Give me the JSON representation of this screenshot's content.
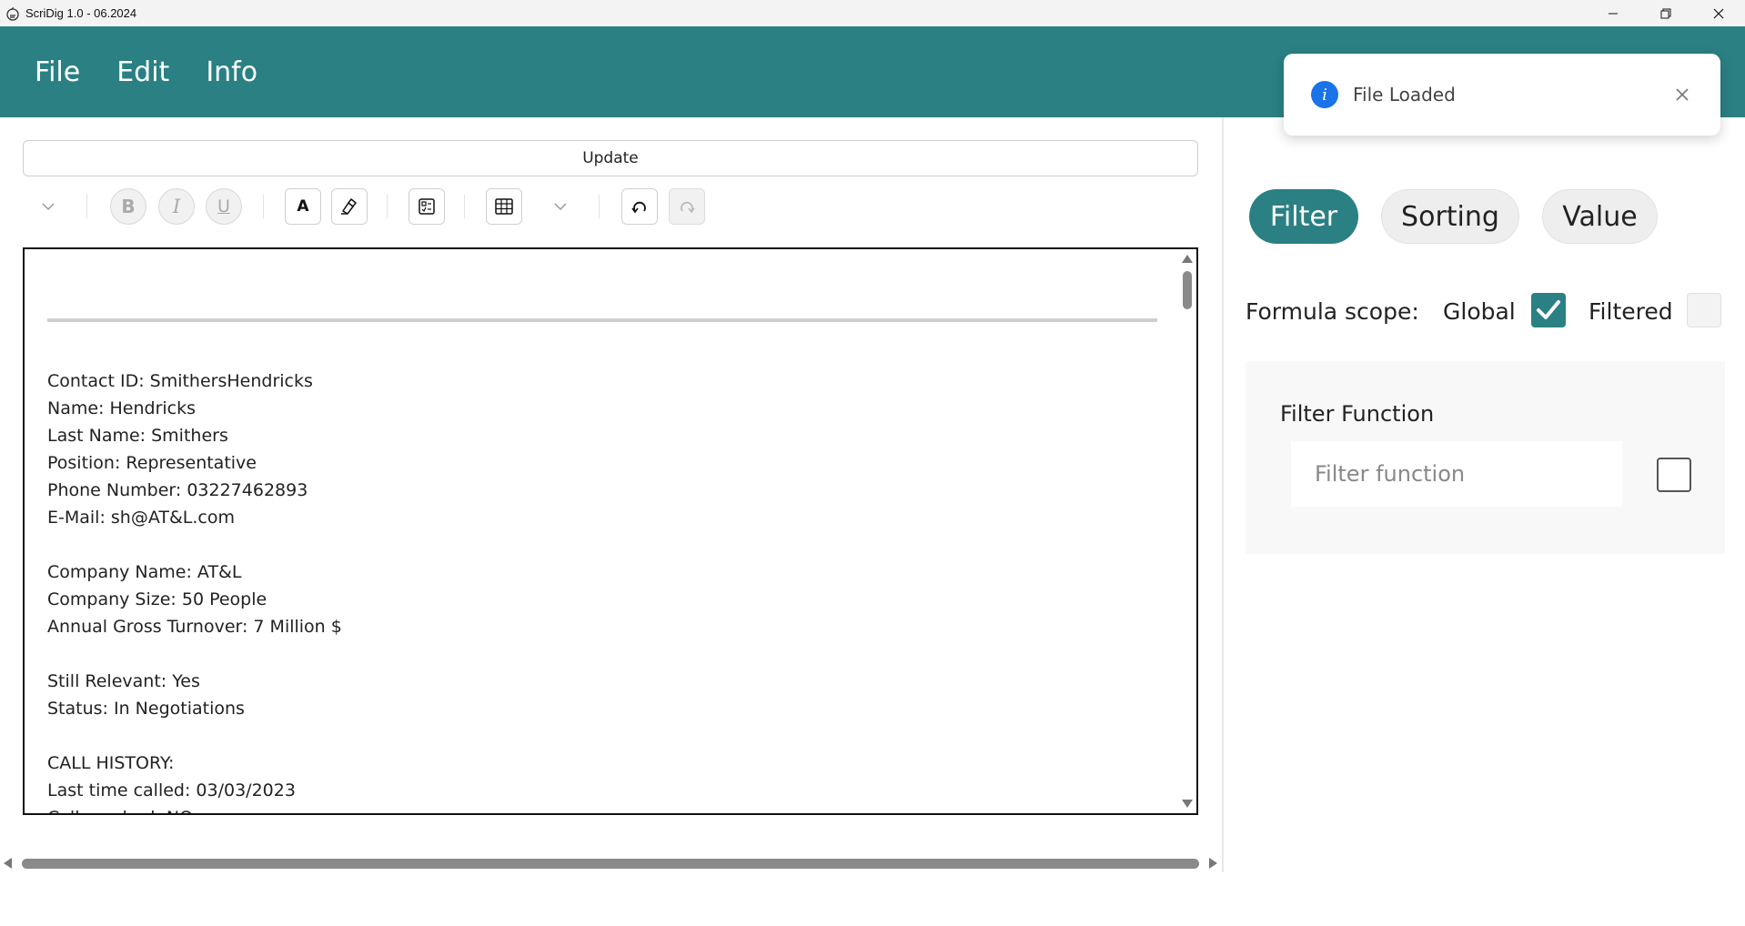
{
  "window": {
    "title": "ScriDig 1.0 - 06.2024",
    "icon": "java-cup-icon"
  },
  "menu": {
    "items": [
      {
        "label": "File"
      },
      {
        "label": "Edit"
      },
      {
        "label": "Info"
      }
    ],
    "background": "#2a8083"
  },
  "toast": {
    "icon": "info-icon",
    "message": "File Loaded",
    "accent": "#1a73e8"
  },
  "editor": {
    "update_label": "Update",
    "toolbar": {
      "bold": "B",
      "italic": "I",
      "underline": "U",
      "font_color": "A"
    },
    "lines": [
      "Contact ID: SmithersHendricks",
      "Name: Hendricks",
      "Last Name: Smithers",
      "Position: Representative",
      "Phone Number: 03227462893",
      "E-Mail: sh@AT&L.com",
      "",
      "Company Name: AT&L",
      "Company Size: 50 People",
      "Annual Gross Turnover: 7 Million $",
      "",
      "Still Relevant: Yes",
      "Status: In Negotiations",
      "",
      "CALL HISTORY:",
      "Last time called: 03/03/2023",
      "Call reached: NO"
    ]
  },
  "right_panel": {
    "tabs": [
      {
        "label": "Filter",
        "active": true
      },
      {
        "label": "Sorting",
        "active": false
      },
      {
        "label": "Value",
        "active": false
      }
    ],
    "scope": {
      "label": "Formula scope:",
      "global_label": "Global",
      "global_checked": true,
      "filtered_label": "Filtered",
      "filtered_checked": false
    },
    "filter": {
      "title": "Filter Function",
      "placeholder": "Filter function",
      "value": "",
      "checked": false
    }
  }
}
